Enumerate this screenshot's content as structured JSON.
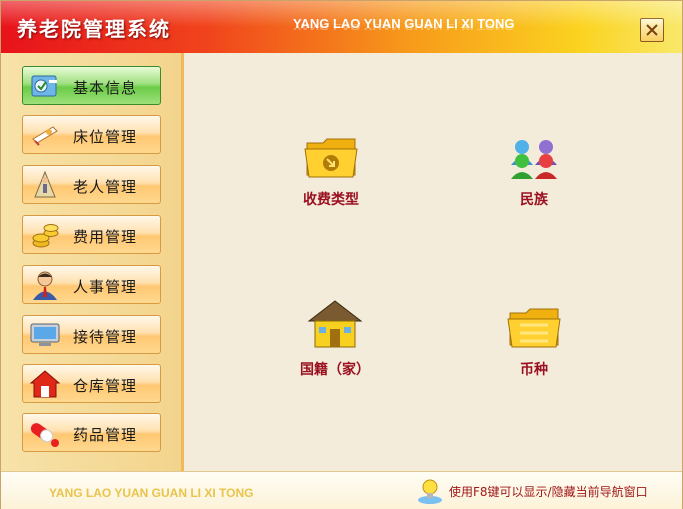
{
  "window": {
    "title": "养老院管理系统",
    "subtitle": "YANG LAO YUAN GUAN LI XI TONG",
    "close_icon": "close-icon"
  },
  "sidebar": {
    "items": [
      {
        "label": "基本信息",
        "icon": "info-icon",
        "active": true
      },
      {
        "label": "床位管理",
        "icon": "bed-icon",
        "active": false
      },
      {
        "label": "老人管理",
        "icon": "elder-icon",
        "active": false
      },
      {
        "label": "费用管理",
        "icon": "coins-icon",
        "active": false
      },
      {
        "label": "人事管理",
        "icon": "person-icon",
        "active": false
      },
      {
        "label": "接待管理",
        "icon": "monitor-icon",
        "active": false
      },
      {
        "label": "仓库管理",
        "icon": "warehouse-icon",
        "active": false
      },
      {
        "label": "药品管理",
        "icon": "pill-icon",
        "active": false
      }
    ]
  },
  "main": {
    "tiles": [
      {
        "label": "收费类型",
        "icon": "folder-arrow-icon"
      },
      {
        "label": "民族",
        "icon": "people-group-icon"
      },
      {
        "label": "国籍（家）",
        "icon": "house-icon"
      },
      {
        "label": "币种",
        "icon": "folder-icon"
      }
    ]
  },
  "footer": {
    "subtitle": "YANG LAO YUAN GUAN LI XI TONG",
    "hint": "使用F8键可以显示/隐藏当前导航窗口",
    "hint_icon": "lightbulb-icon"
  },
  "colors": {
    "title_gradient_start": "#e8121b",
    "title_gradient_end": "#f9e86a",
    "tile_label": "#9a1020",
    "active_button": "#6ccb48"
  }
}
